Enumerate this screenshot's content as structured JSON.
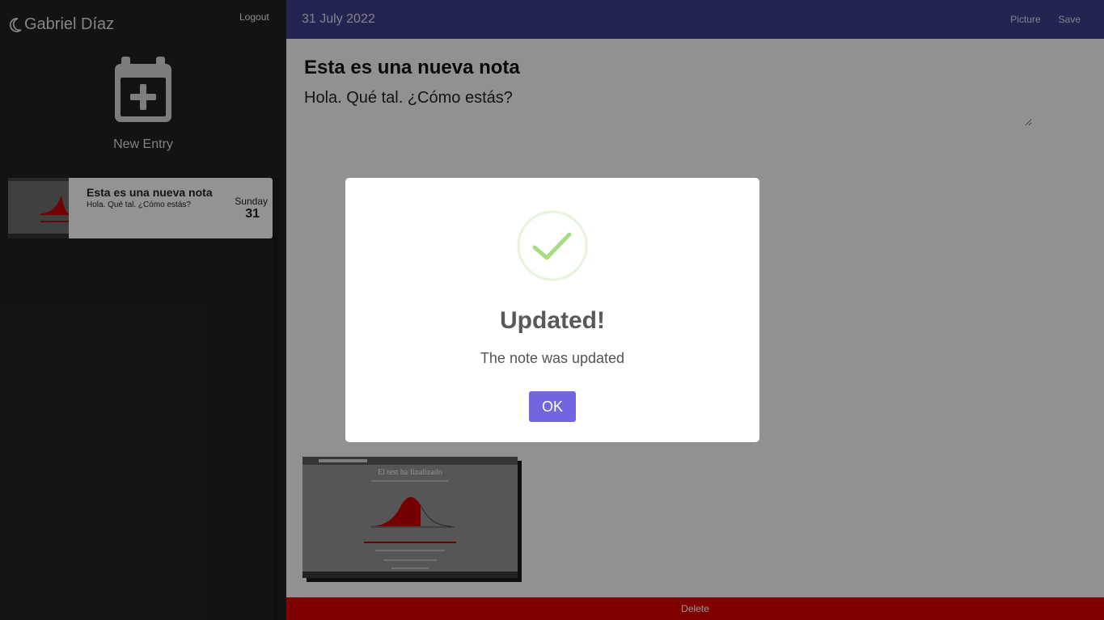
{
  "sidebar": {
    "user_name": "Gabriel Díaz",
    "logout_label": "Logout",
    "new_entry_label": "New Entry",
    "entries": [
      {
        "title": "Esta es una nueva nota",
        "text": "Hola. Qué tal. ¿Cómo estás?",
        "weekday": "Sunday",
        "day": "31"
      }
    ]
  },
  "header": {
    "date": "31 July 2022",
    "picture_label": "Picture",
    "save_label": "Save"
  },
  "note": {
    "title": "Esta es una nueva nota",
    "body": "Hola. Qué tal. ¿Cómo estás?",
    "image_caption": "El test ha finalizado"
  },
  "delete_label": "Delete",
  "dialog": {
    "title": "Updated!",
    "text": "The note was updated",
    "ok_label": "OK"
  },
  "colors": {
    "sidebar_bg": "#212121",
    "header_bg": "#3d3c8a",
    "delete_bg": "#d60000",
    "ok_button": "#7066e0",
    "success_check": "#a5dc86"
  },
  "icons": {
    "brand": "moon-icon",
    "new_entry": "calendar-plus-icon",
    "dialog": "success-check-icon"
  }
}
